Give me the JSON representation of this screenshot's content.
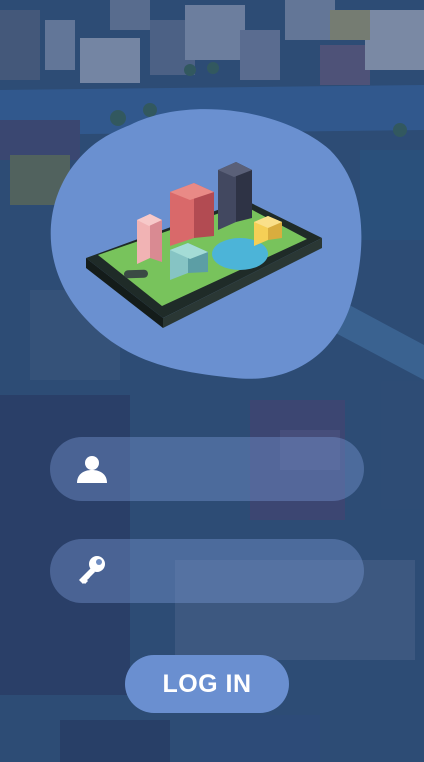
{
  "login": {
    "username": {
      "value": "",
      "placeholder": ""
    },
    "password": {
      "value": "",
      "placeholder": ""
    },
    "button_label": "LOG IN"
  },
  "icons": {
    "logo": "phone-city-logo-icon",
    "username": "user-icon",
    "password": "key-icon"
  },
  "colors": {
    "blob": "#6a90d0",
    "field_fill": "#7896d2",
    "button": "#6a8fd0",
    "text": "#ffffff"
  }
}
